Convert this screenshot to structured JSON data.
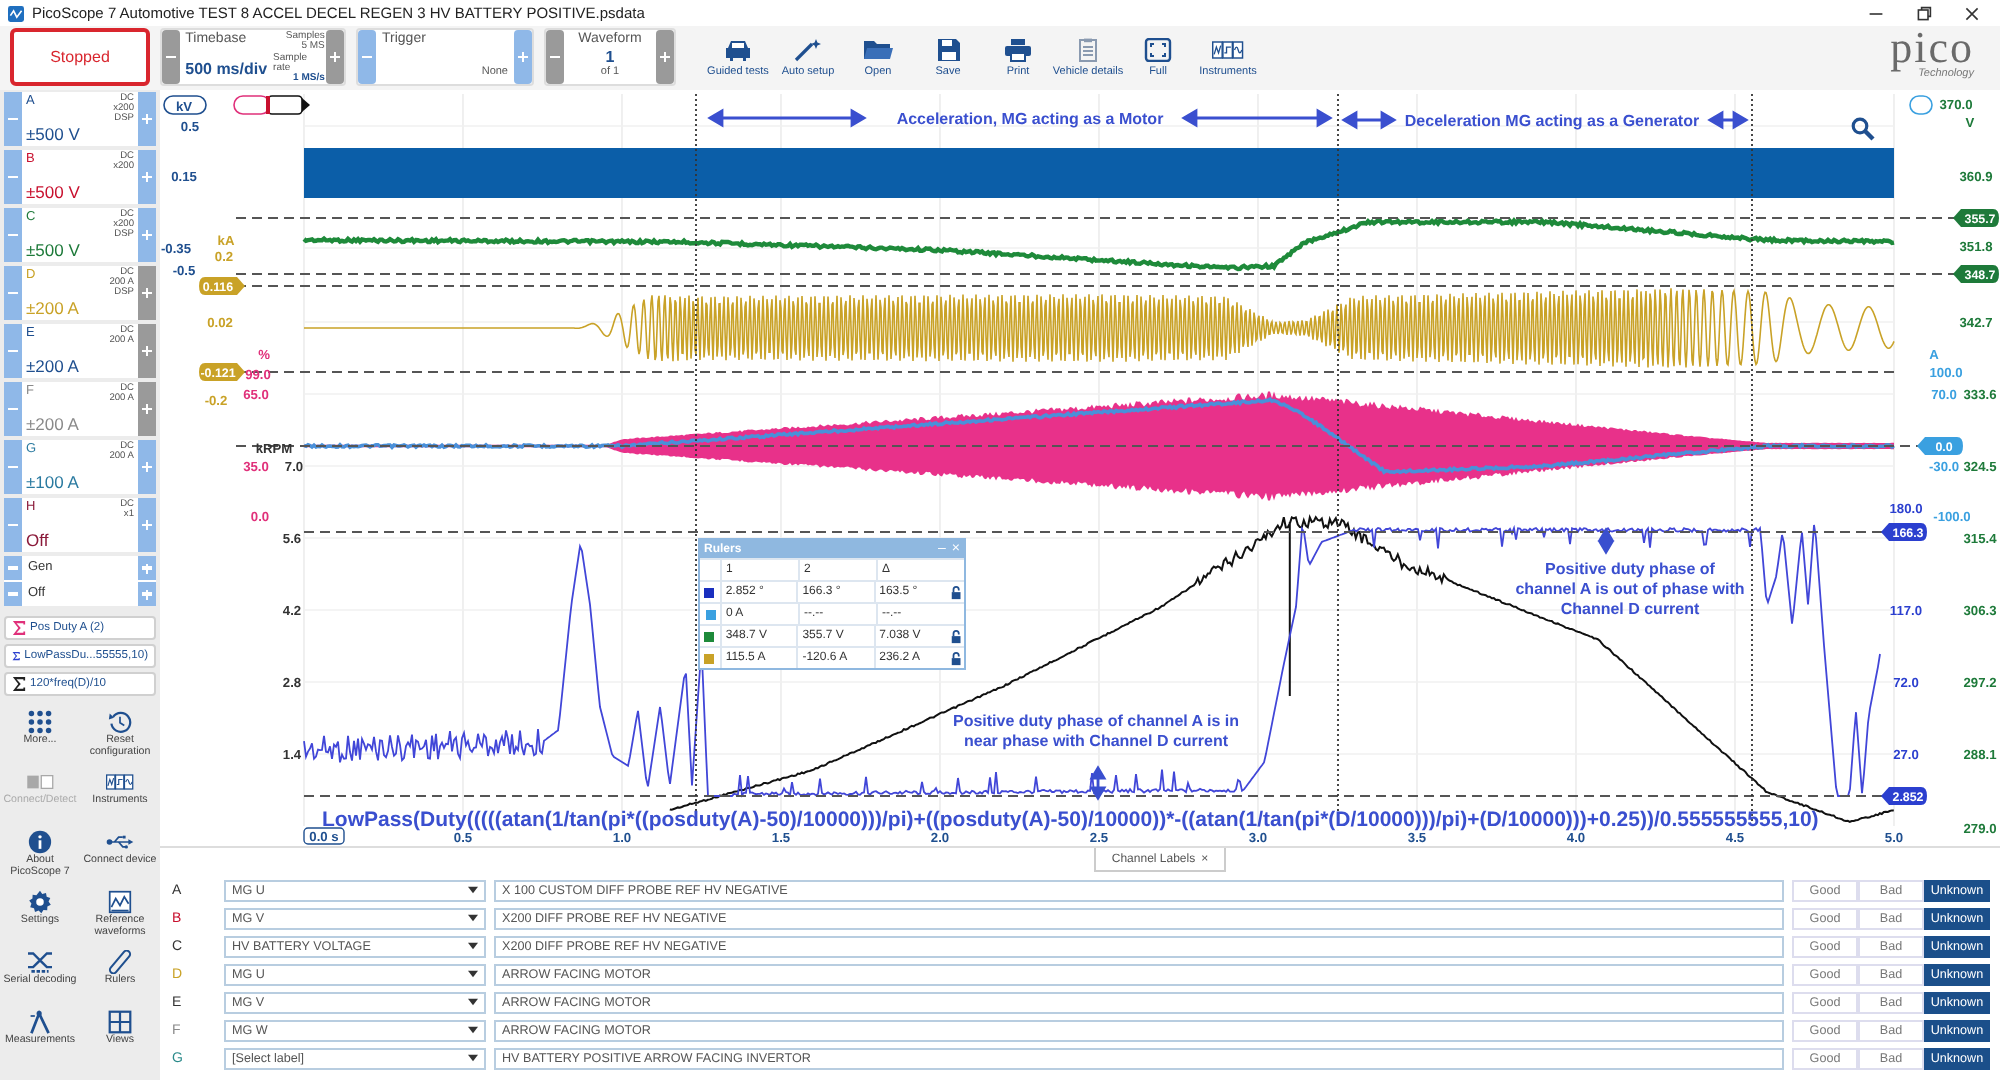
{
  "window": {
    "title": "PicoScope 7 Automotive TEST 8 ACCEL DECEL REGEN 3 HV BATTERY POSITIVE.psdata"
  },
  "toolbar": {
    "run_button": {
      "label": "Stopped"
    },
    "timebase": {
      "label": "Timebase",
      "value": "500 ms/div",
      "samples_label": "Samples",
      "samples": "5 MS",
      "rate_label": "Sample rate",
      "rate": "1 MS/s"
    },
    "trigger": {
      "label": "Trigger",
      "mode": "None"
    },
    "waveform": {
      "label": "Waveform",
      "value": "1",
      "total": "of 1"
    },
    "tools": [
      {
        "kind": "car",
        "label": "Guided tests"
      },
      {
        "kind": "wand",
        "label": "Auto setup"
      },
      {
        "kind": "folder",
        "label": "Open"
      },
      {
        "kind": "save",
        "label": "Save"
      },
      {
        "kind": "print",
        "label": "Print"
      },
      {
        "kind": "clipboard",
        "label": "Vehicle details"
      },
      {
        "kind": "fullscreen",
        "label": "Full"
      },
      {
        "kind": "instruments",
        "label": "Instruments"
      }
    ],
    "logo": {
      "name": "pico",
      "tagline": "Technology"
    }
  },
  "channels": [
    {
      "letter": "A",
      "color": "#1f4f8f",
      "coupling": [
        "DC",
        "x200",
        "DSP"
      ],
      "range": "±500 V",
      "plus_enabled": true
    },
    {
      "letter": "B",
      "color": "#c8102e",
      "coupling": [
        "DC",
        "x200"
      ],
      "range": "±500 V",
      "plus_enabled": true
    },
    {
      "letter": "C",
      "color": "#1e7a3a",
      "coupling": [
        "DC",
        "x200",
        "DSP"
      ],
      "range": "±500 V",
      "plus_enabled": true
    },
    {
      "letter": "D",
      "color": "#c9a227",
      "coupling": [
        "DC",
        "200 A",
        "DSP"
      ],
      "range": "±200 A",
      "plus_enabled": false
    },
    {
      "letter": "E",
      "color": "#1f4f8f",
      "coupling": [
        "DC",
        "200 A"
      ],
      "range": "±200 A",
      "plus_enabled": false
    },
    {
      "letter": "F",
      "color": "#8a8a8a",
      "coupling": [
        "DC",
        "200 A"
      ],
      "range": "±200 A",
      "plus_enabled": false
    },
    {
      "letter": "G",
      "color": "#2a7aa0",
      "coupling": [
        "DC",
        "200 A"
      ],
      "range": "±100 A",
      "plus_enabled": true
    },
    {
      "letter": "H",
      "color": "#8b1a3a",
      "coupling": [
        "DC",
        "x1"
      ],
      "range": "Off",
      "plus_enabled": true
    }
  ],
  "generator": {
    "label": "Gen",
    "state": "Off"
  },
  "math_channels": [
    {
      "label": "Pos Duty A (2)",
      "color": "#e0307a"
    },
    {
      "label": "LowPassDu...55555,10)",
      "color": "#2b3fcf"
    },
    {
      "label": "120*freq(D)/10",
      "color": "#222222"
    }
  ],
  "sidebar_tools": [
    {
      "kind": "more",
      "label": "More...",
      "disabled": false
    },
    {
      "kind": "reset",
      "label": "Reset configuration",
      "disabled": false
    },
    {
      "kind": "connect-detect",
      "label": "Connect/Detect",
      "disabled": true
    },
    {
      "kind": "instruments",
      "label": "Instruments",
      "disabled": false
    },
    {
      "kind": "info",
      "label": "About PicoScope 7",
      "disabled": false
    },
    {
      "kind": "usb",
      "label": "Connect device",
      "disabled": false
    },
    {
      "kind": "settings",
      "label": "Settings",
      "disabled": false
    },
    {
      "kind": "reference",
      "label": "Reference waveforms",
      "disabled": false
    },
    {
      "kind": "serial",
      "label": "Serial decoding",
      "disabled": false
    },
    {
      "kind": "ruler",
      "label": "Rulers",
      "disabled": false
    },
    {
      "kind": "measure",
      "label": "Measurements",
      "disabled": false
    },
    {
      "kind": "views",
      "label": "Views",
      "disabled": false
    }
  ],
  "plot": {
    "axes": [
      {
        "unit": "kV",
        "color": "#1f4f8f",
        "ticks": [
          "0.5",
          "0.15",
          "-0.35",
          "-0.5"
        ]
      },
      {
        "unit": "kA",
        "color": "#c9a227",
        "ticks": [
          "0.2",
          "0.02",
          "-0.2"
        ]
      },
      {
        "unit": "%",
        "color": "#e0307a",
        "ticks": [
          "99.0",
          "65.0",
          "35.0",
          "0.0"
        ]
      },
      {
        "unit": "kRPM",
        "color": "#333333",
        "ticks": [
          "7.0",
          "5.6",
          "4.2",
          "2.8",
          "1.4"
        ]
      },
      {
        "unit": "V",
        "color": "#1e7a3a",
        "ticks": [
          "370.0",
          "360.9",
          "351.8",
          "342.7",
          "333.6",
          "324.5",
          "315.4",
          "306.3",
          "297.2",
          "288.1",
          "279.0"
        ]
      },
      {
        "unit": "A",
        "color": "#3aa0e0",
        "ticks": [
          "100.0",
          "70.0",
          "-30.0",
          "-100.0"
        ]
      },
      {
        "color": "#2b3fcf",
        "ticks": [
          "180.0",
          "117.0",
          "72.0",
          "27.0"
        ]
      }
    ],
    "markers": [
      {
        "text": "0.116",
        "color": "#c9a227"
      },
      {
        "text": "-0.121",
        "color": "#c9a227"
      },
      {
        "text": "355.7",
        "color": "#1e7a3a"
      },
      {
        "text": "348.7",
        "color": "#1e7a3a"
      },
      {
        "text": "0.0",
        "color": "#3aa0e0"
      },
      {
        "text": "166.3",
        "color": "#2b3fcf"
      },
      {
        "text": "2.852",
        "color": "#2b3fcf"
      }
    ],
    "time_badge": "0.0 s",
    "x_ticks": [
      "0.5",
      "1.0",
      "1.5",
      "2.0",
      "2.5",
      "3.0",
      "3.5",
      "4.0",
      "4.5",
      "5.0"
    ],
    "annotations": [
      {
        "kind": "span",
        "lines": [
          "Acceleration, MG acting as a Motor"
        ]
      },
      {
        "kind": "span",
        "lines": [
          "Deceleration MG acting as a Generator"
        ]
      },
      {
        "kind": "note",
        "lines": [
          "Positive duty phase of channel A is in",
          "near phase with Channel D current"
        ]
      },
      {
        "kind": "note",
        "lines": [
          "Positive duty phase of",
          "channel A is out of phase with",
          "Channel D current"
        ]
      }
    ],
    "formula": "LowPass(Duty(((((atan(1/tan(pi*((posduty(A)-50)/10000)))/pi)+((posduty(A)-50)/10000))*-((atan(1/tan(pi*(D/10000)))/pi)+(D/10000)))+0.25))/0.555555555,10)",
    "rulers": {
      "title": "Rulers",
      "minimize": "–",
      "close": "×",
      "columns": [
        "1",
        "2",
        "Δ"
      ],
      "rows": [
        {
          "color": "#1a2fbf",
          "values": [
            "2.852 °",
            "166.3 °",
            "163.5 °"
          ],
          "locked": true
        },
        {
          "color": "#3aa0e0",
          "values": [
            "0 A",
            "--.--",
            "--.--"
          ],
          "locked": false
        },
        {
          "color": "#1e8a3a",
          "values": [
            "348.7 V",
            "355.7 V",
            "7.038 V"
          ],
          "locked": true
        },
        {
          "color": "#c9a227",
          "values": [
            "115.5 A",
            "-120.6 A",
            "236.2 A"
          ],
          "locked": true
        }
      ]
    }
  },
  "channel_labels": {
    "tab": "Channel Labels",
    "tab_close": "×",
    "rows": [
      {
        "letter": "A",
        "color": "#333333",
        "label": "MG U",
        "description": "X 100 CUSTOM DIFF PROBE REF HV NEGATIVE",
        "options": [
          {
            "label": "Good",
            "selected": false
          },
          {
            "label": "Bad",
            "selected": false
          },
          {
            "label": "Unknown",
            "selected": true
          }
        ]
      },
      {
        "letter": "B",
        "color": "#c8102e",
        "label": "MG V",
        "description": "X200 DIFF PROBE REF HV NEGATIVE",
        "options": [
          {
            "label": "Good",
            "selected": false
          },
          {
            "label": "Bad",
            "selected": false
          },
          {
            "label": "Unknown",
            "selected": true
          }
        ]
      },
      {
        "letter": "C",
        "color": "#333333",
        "label": "HV BATTERY VOLTAGE",
        "description": "X200 DIFF PROBE REF HV NEGATIVE",
        "options": [
          {
            "label": "Good",
            "selected": false
          },
          {
            "label": "Bad",
            "selected": false
          },
          {
            "label": "Unknown",
            "selected": true
          }
        ]
      },
      {
        "letter": "D",
        "color": "#c9a227",
        "label": "MG U",
        "description": "ARROW FACING MOTOR",
        "options": [
          {
            "label": "Good",
            "selected": false
          },
          {
            "label": "Bad",
            "selected": false
          },
          {
            "label": "Unknown",
            "selected": true
          }
        ]
      },
      {
        "letter": "E",
        "color": "#333333",
        "label": "MG V",
        "description": "ARROW FACING MOTOR",
        "options": [
          {
            "label": "Good",
            "selected": false
          },
          {
            "label": "Bad",
            "selected": false
          },
          {
            "label": "Unknown",
            "selected": true
          }
        ]
      },
      {
        "letter": "F",
        "color": "#8a8a8a",
        "label": "MG W",
        "description": "ARROW FACING MOTOR",
        "options": [
          {
            "label": "Good",
            "selected": false
          },
          {
            "label": "Bad",
            "selected": false
          },
          {
            "label": "Unknown",
            "selected": true
          }
        ]
      },
      {
        "letter": "G",
        "color": "#2a8a8a",
        "label": "[Select label]",
        "description": "HV BATTERY POSITIVE ARROW FACING INVERTOR",
        "options": [
          {
            "label": "Good",
            "selected": false
          },
          {
            "label": "Bad",
            "selected": false
          },
          {
            "label": "Unknown",
            "selected": true
          }
        ]
      }
    ]
  }
}
